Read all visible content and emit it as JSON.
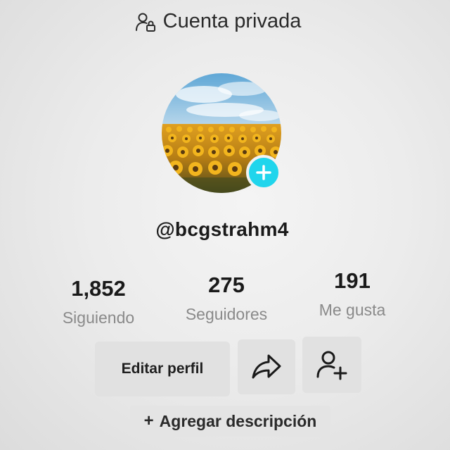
{
  "header": {
    "title": "Cuenta privada",
    "icon": "private-account-icon"
  },
  "profile": {
    "username": "@bcgstrahm4",
    "avatar": "sunflower-field-photo"
  },
  "stats": [
    {
      "value": "1,852",
      "label": "Siguiendo"
    },
    {
      "value": "275",
      "label": "Seguidores"
    },
    {
      "value": "191",
      "label": "Me gusta"
    }
  ],
  "actions": {
    "edit_profile": "Editar perfil",
    "share_icon": "share-icon",
    "add_friend_icon": "add-friend-icon"
  },
  "description": {
    "plus": "+",
    "label": "Agregar descripción"
  },
  "colors": {
    "accent": "#20d5ec",
    "text": "#1a1a1a",
    "muted": "#8a8a8a"
  }
}
